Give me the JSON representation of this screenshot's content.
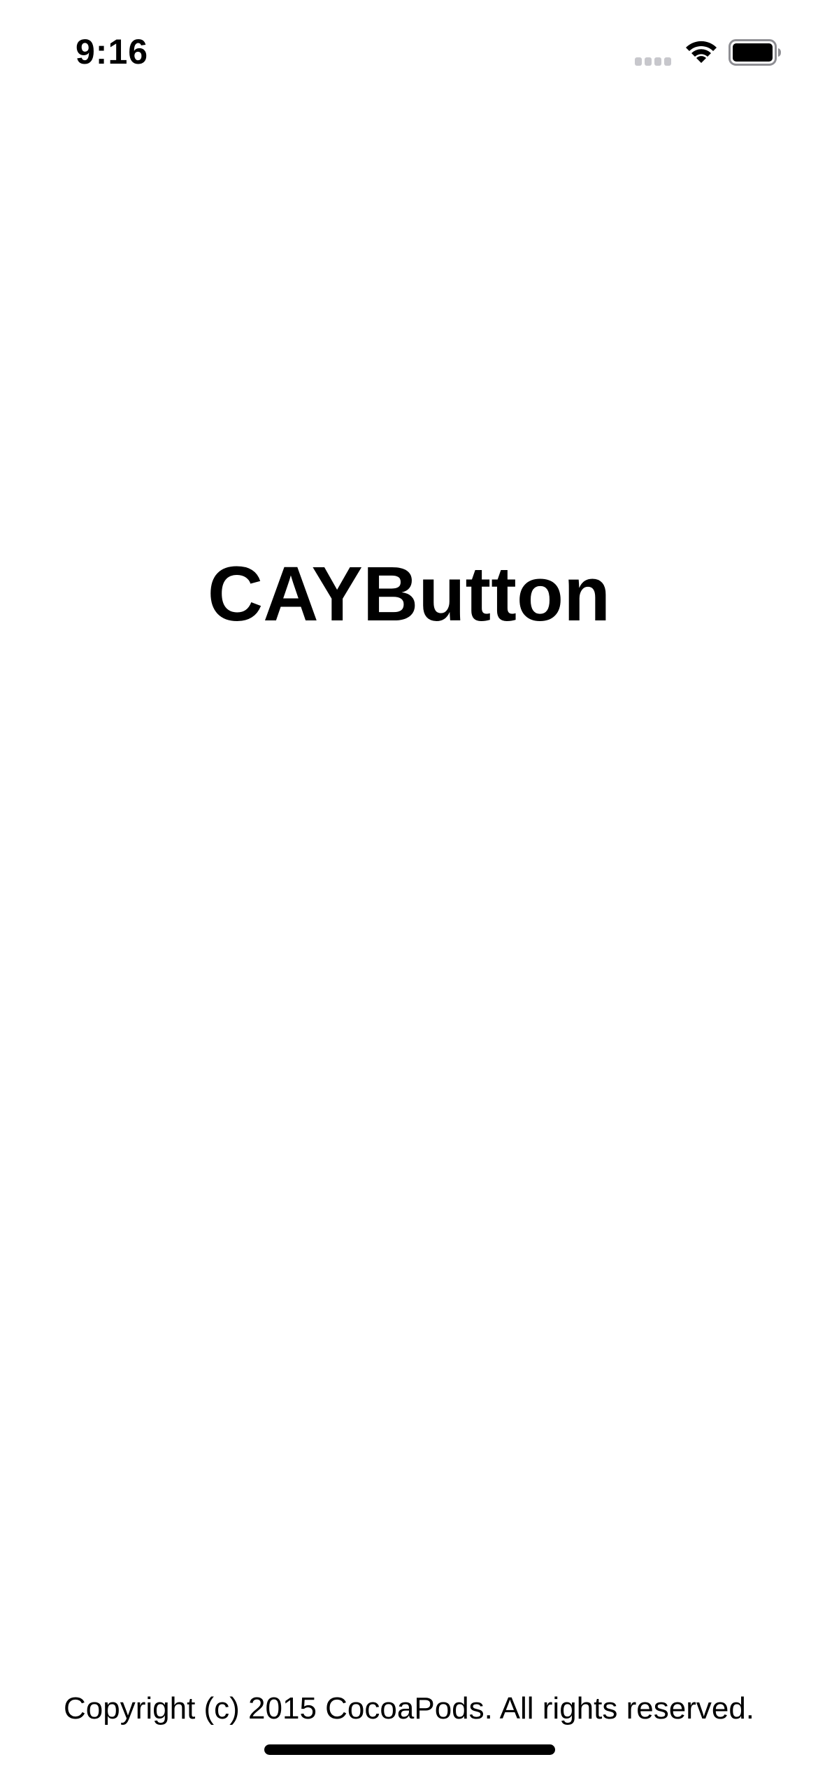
{
  "status_bar": {
    "time": "9:16",
    "icons": [
      "cellular-signal-icon",
      "wifi-icon",
      "battery-icon"
    ]
  },
  "launch_screen": {
    "title": "CAYButton",
    "copyright": "Copyright (c) 2015 CocoaPods. All rights reserved."
  },
  "colors": {
    "background": "#ffffff",
    "text": "#000000",
    "inactive_signal": "#c7c7cc"
  }
}
